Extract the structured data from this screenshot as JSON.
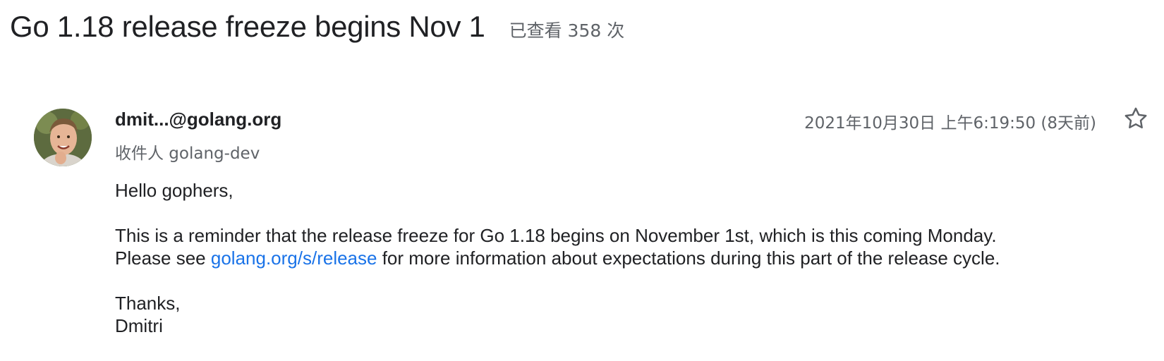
{
  "thread": {
    "title": "Go 1.18 release freeze begins Nov 1",
    "view_count": "已查看 358 次"
  },
  "message": {
    "sender": "dmit...@golang.org",
    "recipients": "收件人 golang-dev",
    "timestamp": "2021年10月30日 上午6:19:50 (8天前)",
    "star_icon": "star-outline-icon",
    "body": {
      "greeting": "Hello gophers,",
      "line1": "This is a reminder that the release freeze for Go 1.18 begins on November 1st, which is this coming Monday.",
      "line2_before": "Please see ",
      "link_text": "golang.org/s/release",
      "line2_after": " for more information about expectations during this part of the release cycle.",
      "closing": "Thanks,",
      "signature": "Dmitri"
    }
  },
  "colors": {
    "link": "#1a73e8",
    "secondary_text": "#5f6368",
    "primary_text": "#202124"
  }
}
